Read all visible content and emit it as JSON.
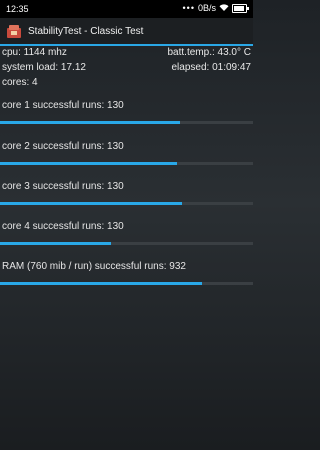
{
  "status_bar": {
    "time": "12:35",
    "signal_dots": "•••",
    "speed": "0B/s",
    "wifi_icon": "wifi-icon",
    "battery_icon": "battery-icon"
  },
  "app_bar": {
    "title": "StabilityTest - Classic Test",
    "icon": "app-icon"
  },
  "info": {
    "cpu": "cpu: 1144 mhz",
    "batt_temp": "batt.temp.: 43.0° C",
    "system_load": "system load: 17.12",
    "elapsed": "elapsed: 01:09:47",
    "cores": "cores: 4"
  },
  "tests": [
    {
      "label": "core 1 successful runs: 130",
      "progress": 0.71
    },
    {
      "label": "core 2 successful runs: 130",
      "progress": 0.7
    },
    {
      "label": "core 3 successful runs: 130",
      "progress": 0.72
    },
    {
      "label": "core 4 successful runs: 130",
      "progress": 0.44
    },
    {
      "label": "RAM (760 mib / run) successful runs: 932",
      "progress": 0.8
    }
  ],
  "colors": {
    "accent": "#29a8e8",
    "track": "#3a3f43"
  }
}
